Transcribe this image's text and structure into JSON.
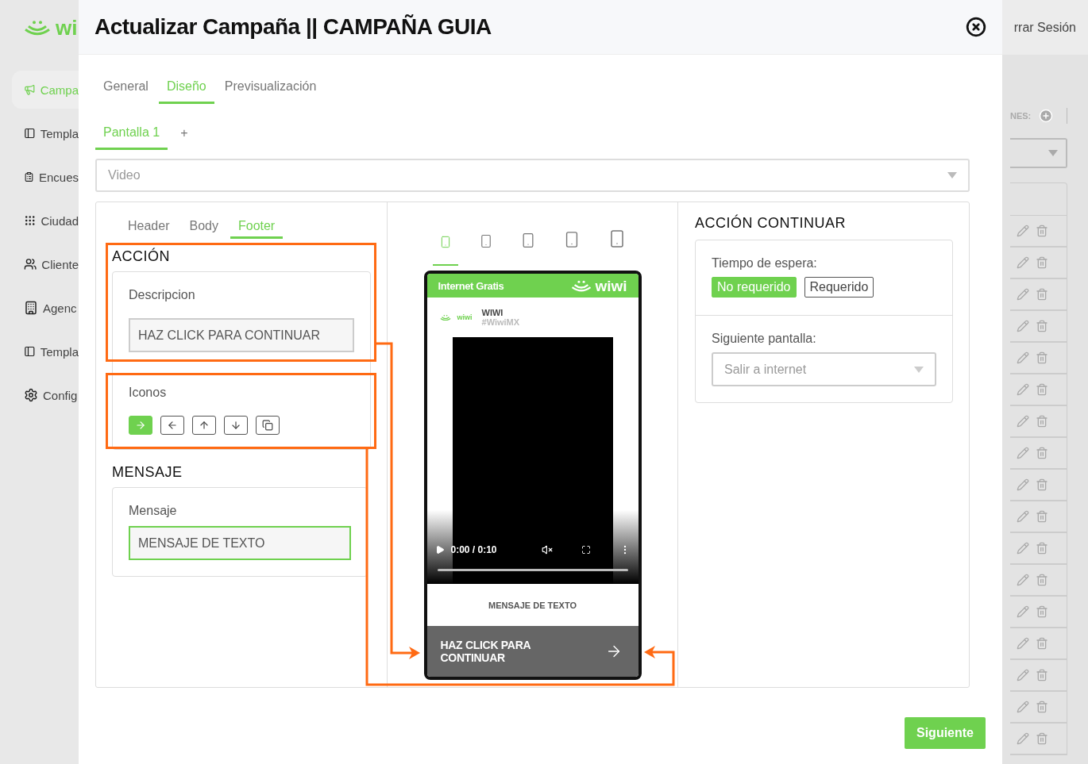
{
  "app": {
    "logo": {
      "text": "wi"
    },
    "sidebar": {
      "items": [
        {
          "label": "Campa",
          "selected": true
        },
        {
          "label": "Templa",
          "selected": false
        },
        {
          "label": "Encues",
          "selected": false
        },
        {
          "label": "Ciudad",
          "selected": false
        },
        {
          "label": "Cliente",
          "selected": false
        },
        {
          "label": "Agenc",
          "selected": false
        },
        {
          "label": "Templa",
          "selected": false
        },
        {
          "label": "Config",
          "selected": false
        }
      ]
    },
    "session_link": "rrar Sesión",
    "list": {
      "label": "NES:"
    }
  },
  "modal": {
    "title": "Actualizar Campaña || CAMPAÑA GUIA",
    "tabs": [
      {
        "label": "General",
        "selected": false
      },
      {
        "label": "Diseño",
        "selected": true
      },
      {
        "label": "Previsualización",
        "selected": false
      }
    ],
    "screens": {
      "tabs": [
        {
          "label": "Pantalla 1",
          "selected": true
        }
      ],
      "add": "+"
    },
    "type_select": {
      "value": "Video"
    },
    "section_tabs": [
      {
        "label": "Header",
        "selected": false
      },
      {
        "label": "Body",
        "selected": false
      },
      {
        "label": "Footer",
        "selected": true
      }
    ],
    "action": {
      "title": "ACCIÓN",
      "description": {
        "label": "Descripcion",
        "value": "HAZ CLICK PARA CONTINUAR"
      },
      "icons": {
        "label": "Iconos",
        "options": [
          {
            "kind": "arrow-right",
            "selected": true
          },
          {
            "kind": "arrow-left",
            "selected": false
          },
          {
            "kind": "arrow-up",
            "selected": false
          },
          {
            "kind": "arrow-down",
            "selected": false
          },
          {
            "kind": "copy",
            "selected": false
          }
        ]
      }
    },
    "message": {
      "title": "MENSAJE",
      "label": "Mensaje",
      "value": "MENSAJE DE TEXTO",
      "focused": true
    },
    "preview": {
      "devices": [
        {
          "selected": true
        },
        {
          "selected": false
        },
        {
          "selected": false
        },
        {
          "selected": false
        },
        {
          "selected": false
        }
      ],
      "banner": "Internet Gratis",
      "logo": "wiwi",
      "small_logo": "wiwi",
      "brand_name": "WIWI",
      "brand_tag": "#WiwiMX",
      "video": {
        "time": "0:00 / 0:10"
      },
      "message": "MENSAJE DE TEXTO",
      "button": "HAZ CLICK PARA CONTINUAR"
    },
    "continue_action": {
      "title": "ACCIÓN CONTINUAR",
      "wait": {
        "label": "Tiempo de espera:",
        "options": [
          {
            "label": "No requerido",
            "selected": true
          },
          {
            "label": "Requerido",
            "selected": false
          }
        ]
      },
      "next_screen": {
        "label": "Siguiente pantalla:",
        "placeholder": "Salir a internet"
      }
    },
    "next_button": "Siguiente"
  }
}
